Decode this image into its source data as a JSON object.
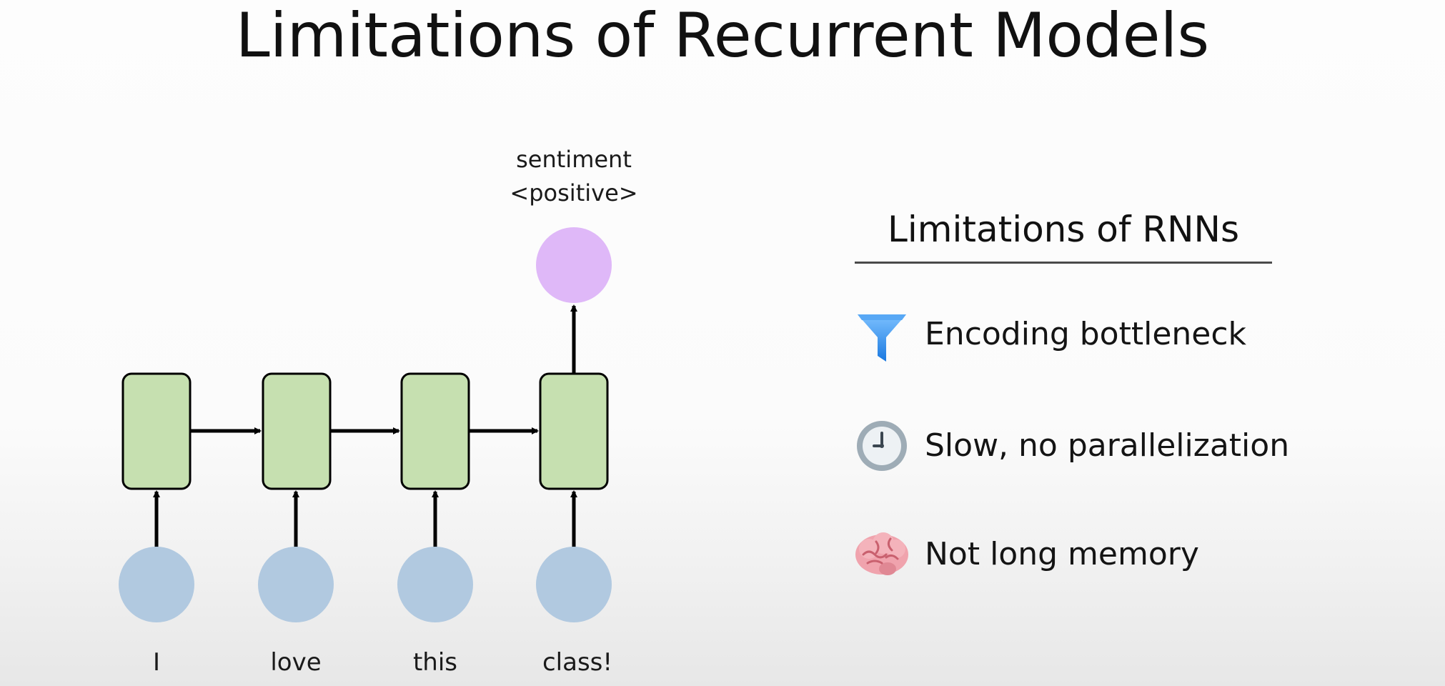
{
  "title": "Limitations of Recurrent Models",
  "diagram": {
    "output": {
      "line1": "sentiment",
      "line2": "<positive>"
    },
    "colors": {
      "output_node": "#dfb8f8",
      "cell": "#c6e0b0",
      "input_node": "#b1c9e0",
      "arrow": "#000000"
    },
    "inputs": [
      "I",
      "love",
      "this",
      "class!"
    ]
  },
  "panel": {
    "heading": "Limitations of RNNs",
    "items": [
      {
        "icon": "funnel-icon",
        "label": "Encoding bottleneck"
      },
      {
        "icon": "clock-icon",
        "label": "Slow, no parallelization"
      },
      {
        "icon": "brain-icon",
        "label": "Not long memory"
      }
    ]
  }
}
